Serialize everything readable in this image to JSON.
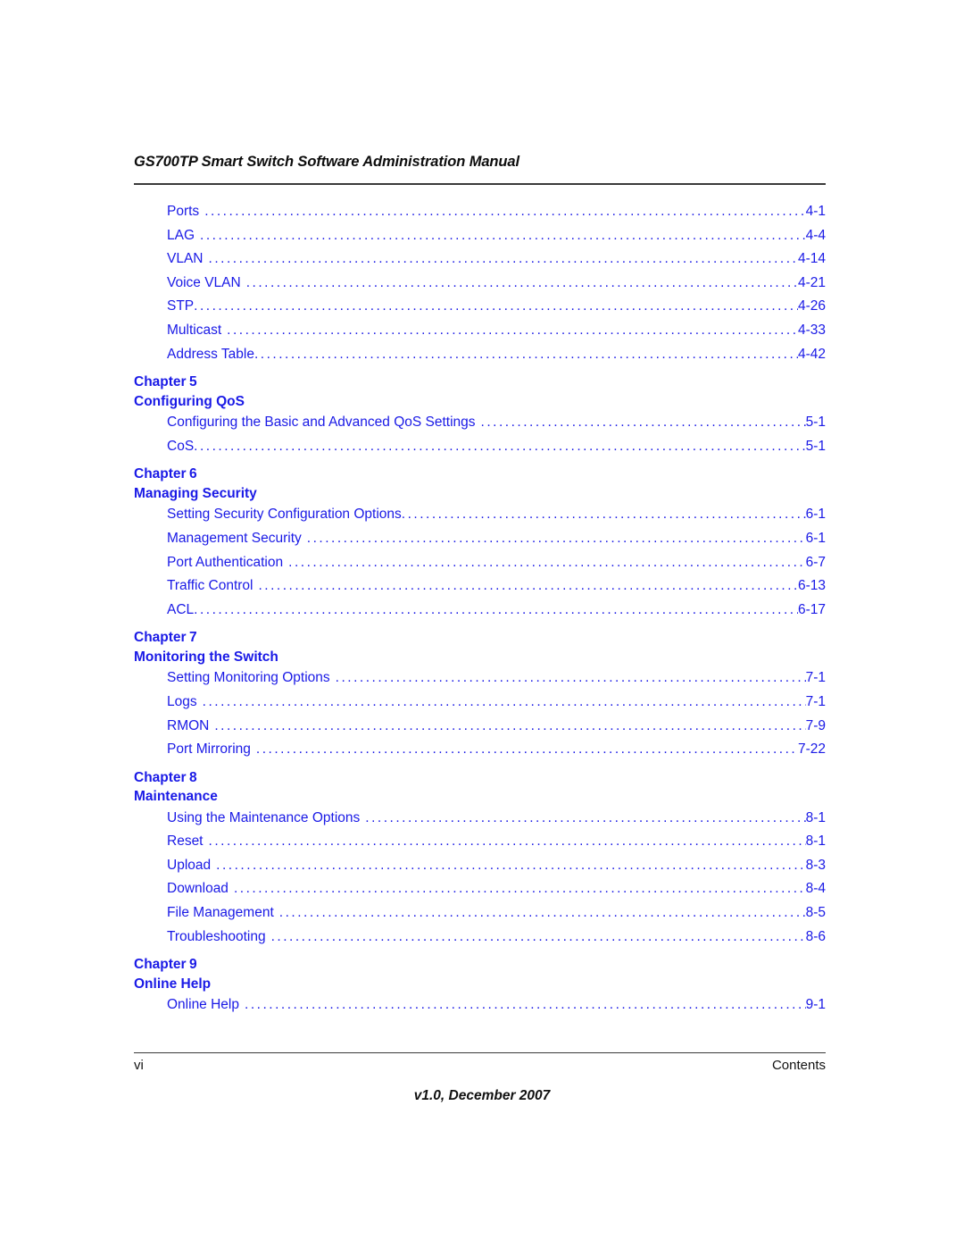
{
  "header": {
    "title": "GS700TP Smart Switch Software Administration Manual"
  },
  "toc": {
    "leading_entries": [
      {
        "title": "Ports",
        "page": "4-1",
        "gap": true
      },
      {
        "title": "LAG",
        "page": "4-4",
        "gap": true
      },
      {
        "title": "VLAN",
        "page": "4-14",
        "gap": true
      },
      {
        "title": "Voice VLAN",
        "page": "4-21",
        "gap": true
      },
      {
        "title": "STP",
        "page": "4-26",
        "gap": false
      },
      {
        "title": "Multicast",
        "page": "4-33",
        "gap": true
      },
      {
        "title": "Address Table",
        "page": "4-42",
        "gap": false
      }
    ],
    "chapters": [
      {
        "label": "Chapter",
        "number": "5",
        "title": "Configuring QoS",
        "entries": [
          {
            "title": "Configuring the Basic and Advanced QoS Settings",
            "page": "5-1",
            "gap": true
          },
          {
            "title": "CoS",
            "page": "5-1",
            "gap": false
          }
        ]
      },
      {
        "label": "Chapter",
        "number": "6",
        "title": "Managing Security",
        "entries": [
          {
            "title": "Setting Security Configuration Options",
            "page": "6-1",
            "gap": false
          },
          {
            "title": "Management Security",
            "page": "6-1",
            "gap": true
          },
          {
            "title": "Port Authentication",
            "page": "6-7",
            "gap": true
          },
          {
            "title": "Traffic Control",
            "page": "6-13",
            "gap": true
          },
          {
            "title": "ACL",
            "page": "6-17",
            "gap": false
          }
        ]
      },
      {
        "label": "Chapter",
        "number": "7",
        "title": "Monitoring the Switch",
        "entries": [
          {
            "title": "Setting Monitoring Options",
            "page": "7-1",
            "gap": true
          },
          {
            "title": "Logs",
            "page": "7-1",
            "gap": true
          },
          {
            "title": "RMON",
            "page": "7-9",
            "gap": true
          },
          {
            "title": "Port Mirroring",
            "page": "7-22",
            "gap": true
          }
        ]
      },
      {
        "label": "Chapter",
        "number": "8",
        "title": "Maintenance",
        "entries": [
          {
            "title": "Using the Maintenance Options",
            "page": "8-1",
            "gap": true
          },
          {
            "title": "Reset",
            "page": "8-1",
            "gap": true
          },
          {
            "title": "Upload",
            "page": "8-3",
            "gap": true
          },
          {
            "title": "Download",
            "page": "8-4",
            "gap": true
          },
          {
            "title": "File Management",
            "page": "8-5",
            "gap": true
          },
          {
            "title": "Troubleshooting",
            "page": "8-6",
            "gap": true
          }
        ]
      },
      {
        "label": "Chapter",
        "number": "9",
        "title": "Online Help",
        "entries": [
          {
            "title": "Online Help",
            "page": "9-1",
            "gap": true
          }
        ]
      }
    ]
  },
  "footer": {
    "page_number": "vi",
    "section": "Contents",
    "version": "v1.0, December 2007"
  },
  "colors": {
    "link_blue": "#1a1ae6",
    "text_black": "#111111",
    "rule_gray": "#3a3a3a"
  }
}
